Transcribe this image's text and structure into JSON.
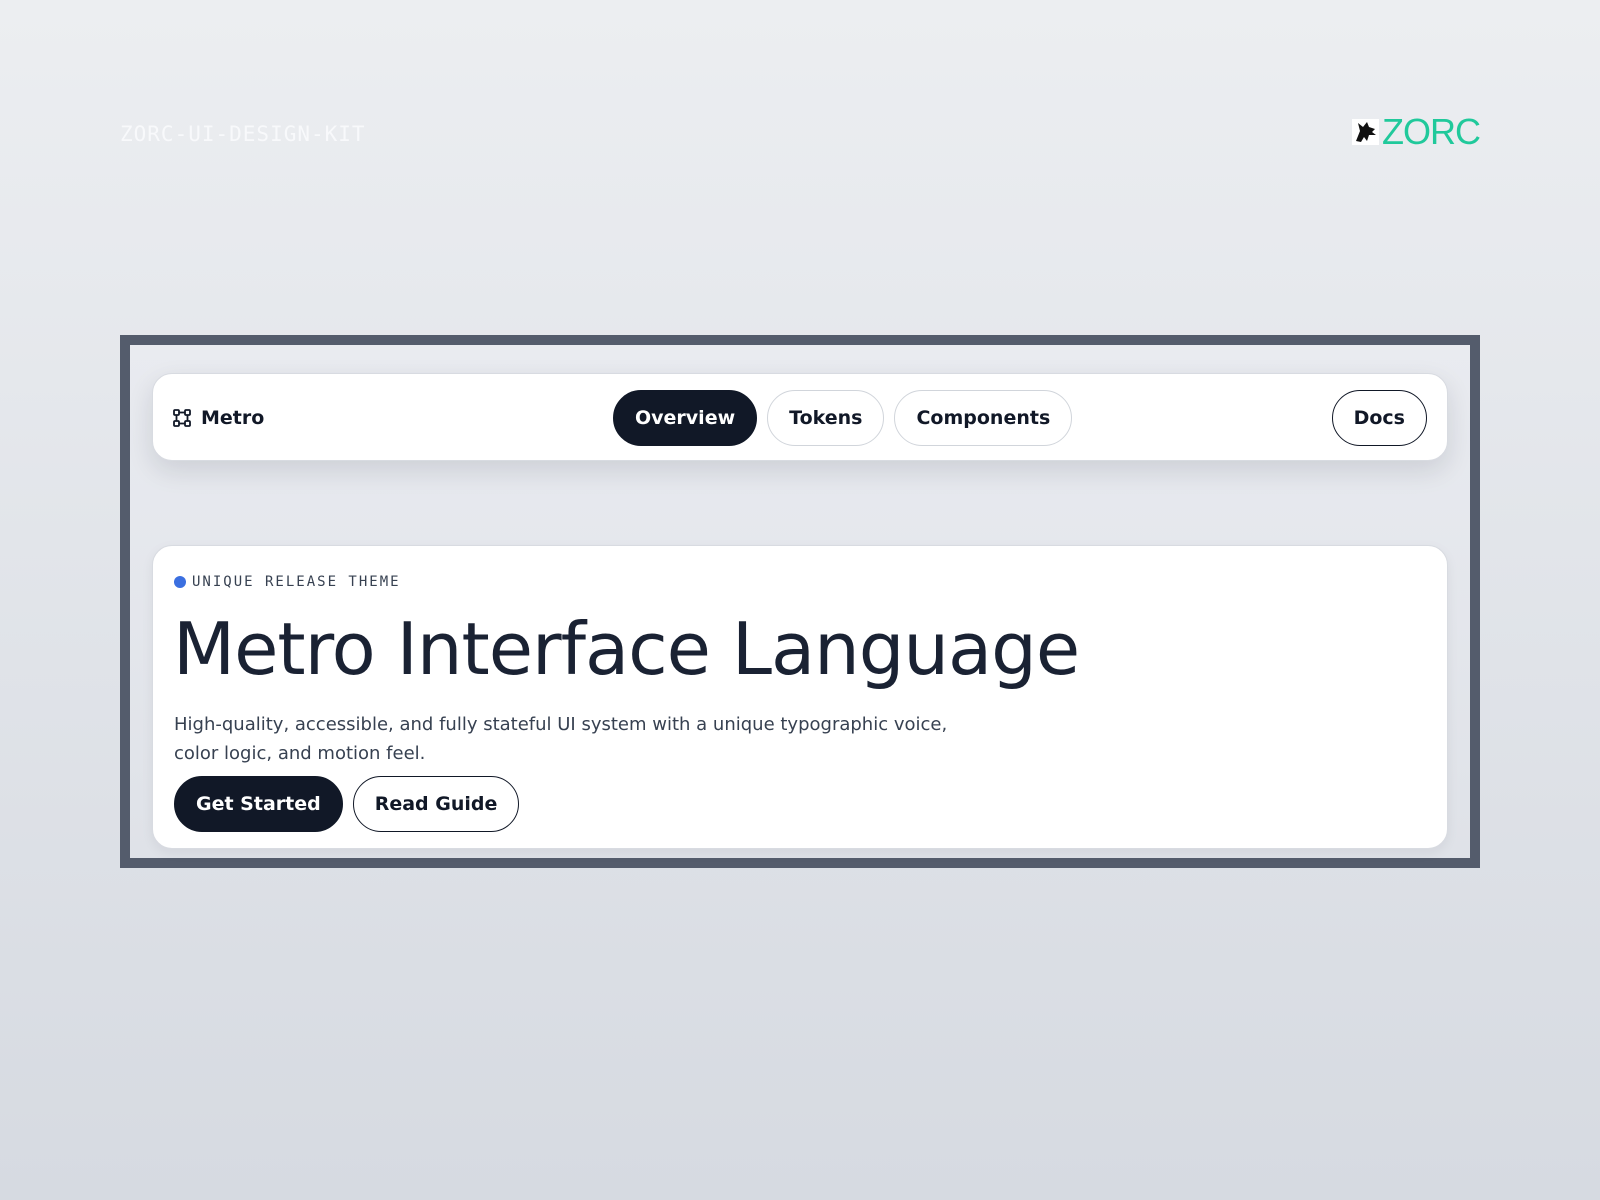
{
  "page": {
    "kit_label": "ZORC-UI-DESIGN-KIT",
    "logo": {
      "word": "ZORC",
      "mark_icon": "wolf-head-icon",
      "color": "#20c99b"
    }
  },
  "navbar": {
    "brand": {
      "icon": "frame-select-icon",
      "name": "Metro"
    },
    "tabs": [
      {
        "label": "Overview",
        "active": true
      },
      {
        "label": "Tokens",
        "active": false
      },
      {
        "label": "Components",
        "active": false
      }
    ],
    "docs_label": "Docs"
  },
  "hero": {
    "eyebrow": "UNIQUE RELEASE THEME",
    "eyebrow_dot_color": "#3b6fe0",
    "title": "Metro Interface Language",
    "description": "High-quality, accessible, and fully stateful UI system with a unique typographic voice, color logic, and motion feel.",
    "primary_cta": "Get Started",
    "secondary_cta": "Read Guide"
  },
  "colors": {
    "ink": "#111827",
    "frame": "#545c6c",
    "accent_green": "#20c99b",
    "accent_blue": "#3b6fe0"
  }
}
